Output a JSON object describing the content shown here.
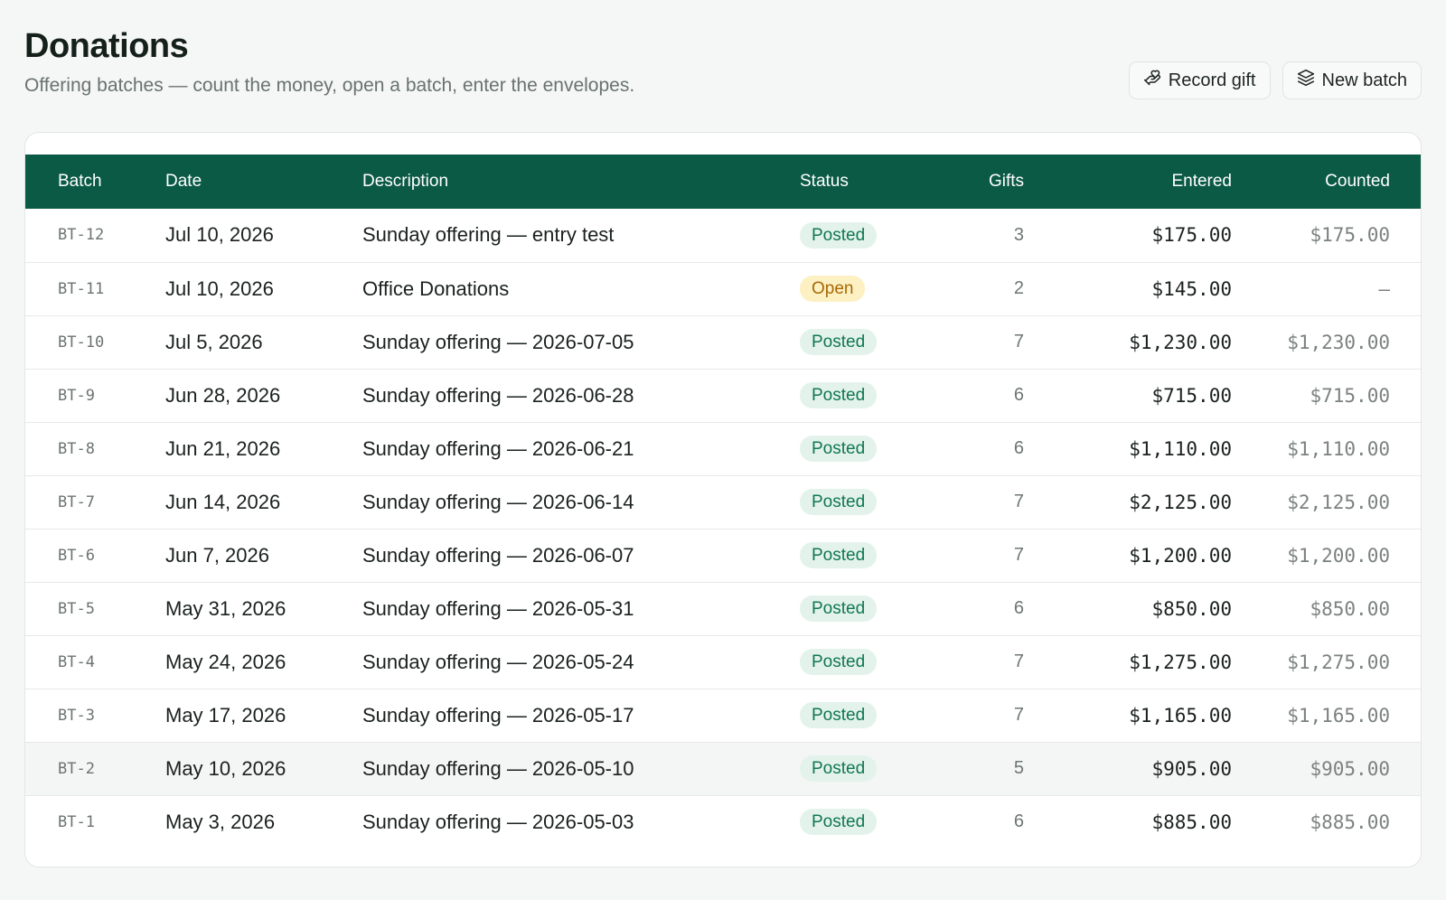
{
  "header": {
    "title": "Donations",
    "subtitle": "Offering batches — count the money, open a batch, enter the envelopes."
  },
  "actions": {
    "record_gift_label": "Record gift",
    "new_batch_label": "New batch"
  },
  "table": {
    "columns": {
      "batch": "Batch",
      "date": "Date",
      "description": "Description",
      "status": "Status",
      "gifts": "Gifts",
      "entered": "Entered",
      "counted": "Counted"
    },
    "rows": [
      {
        "batch": "BT-12",
        "date": "Jul 10, 2026",
        "description": "Sunday offering — entry test",
        "status": "Posted",
        "status_kind": "posted",
        "gifts": "3",
        "entered": "$175.00",
        "counted": "$175.00"
      },
      {
        "batch": "BT-11",
        "date": "Jul 10, 2026",
        "description": "Office Donations",
        "status": "Open",
        "status_kind": "open",
        "gifts": "2",
        "entered": "$145.00",
        "counted": "—"
      },
      {
        "batch": "BT-10",
        "date": "Jul 5, 2026",
        "description": "Sunday offering — 2026-07-05",
        "status": "Posted",
        "status_kind": "posted",
        "gifts": "7",
        "entered": "$1,230.00",
        "counted": "$1,230.00"
      },
      {
        "batch": "BT-9",
        "date": "Jun 28, 2026",
        "description": "Sunday offering — 2026-06-28",
        "status": "Posted",
        "status_kind": "posted",
        "gifts": "6",
        "entered": "$715.00",
        "counted": "$715.00"
      },
      {
        "batch": "BT-8",
        "date": "Jun 21, 2026",
        "description": "Sunday offering — 2026-06-21",
        "status": "Posted",
        "status_kind": "posted",
        "gifts": "6",
        "entered": "$1,110.00",
        "counted": "$1,110.00"
      },
      {
        "batch": "BT-7",
        "date": "Jun 14, 2026",
        "description": "Sunday offering — 2026-06-14",
        "status": "Posted",
        "status_kind": "posted",
        "gifts": "7",
        "entered": "$2,125.00",
        "counted": "$2,125.00"
      },
      {
        "batch": "BT-6",
        "date": "Jun 7, 2026",
        "description": "Sunday offering — 2026-06-07",
        "status": "Posted",
        "status_kind": "posted",
        "gifts": "7",
        "entered": "$1,200.00",
        "counted": "$1,200.00"
      },
      {
        "batch": "BT-5",
        "date": "May 31, 2026",
        "description": "Sunday offering — 2026-05-31",
        "status": "Posted",
        "status_kind": "posted",
        "gifts": "6",
        "entered": "$850.00",
        "counted": "$850.00"
      },
      {
        "batch": "BT-4",
        "date": "May 24, 2026",
        "description": "Sunday offering — 2026-05-24",
        "status": "Posted",
        "status_kind": "posted",
        "gifts": "7",
        "entered": "$1,275.00",
        "counted": "$1,275.00"
      },
      {
        "batch": "BT-3",
        "date": "May 17, 2026",
        "description": "Sunday offering — 2026-05-17",
        "status": "Posted",
        "status_kind": "posted",
        "gifts": "7",
        "entered": "$1,165.00",
        "counted": "$1,165.00"
      },
      {
        "batch": "BT-2",
        "date": "May 10, 2026",
        "description": "Sunday offering — 2026-05-10",
        "status": "Posted",
        "status_kind": "posted",
        "gifts": "5",
        "entered": "$905.00",
        "counted": "$905.00",
        "hovered": true
      },
      {
        "batch": "BT-1",
        "date": "May 3, 2026",
        "description": "Sunday offering — 2026-05-03",
        "status": "Posted",
        "status_kind": "posted",
        "gifts": "6",
        "entered": "$885.00",
        "counted": "$885.00"
      }
    ]
  },
  "icons": {
    "record_gift": "hand-heart-icon",
    "new_batch": "layers-icon"
  },
  "colors": {
    "header_bg": "#0b5a46",
    "posted_bg": "#e3f3ec",
    "posted_text": "#11774f",
    "open_bg": "#fdf0c2",
    "open_text": "#a66a06"
  }
}
